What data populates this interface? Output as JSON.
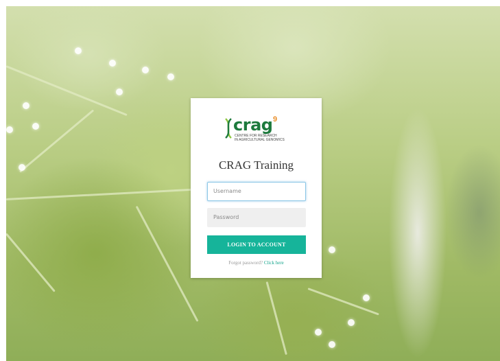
{
  "background": {
    "description_icon": "blurred-plant-photo"
  },
  "logo": {
    "wordmark": "crag",
    "superscript": "9",
    "subtitle_line1": "CENTRE FOR RESEARCH",
    "subtitle_line2": "IN AGRICULTURAL GENOMICS",
    "icon": "dna-helix-icon",
    "brand_green": "#1d7a3d",
    "brand_orange": "#e98f2b"
  },
  "login": {
    "title": "CRAG Training",
    "username_placeholder": "Username",
    "username_value": "",
    "password_placeholder": "Password",
    "password_value": "",
    "submit_label": "LOGIN TO ACCOUNT",
    "forgot_text": "Forgot password?",
    "forgot_link": "Click here",
    "accent_color": "#16b49a"
  }
}
